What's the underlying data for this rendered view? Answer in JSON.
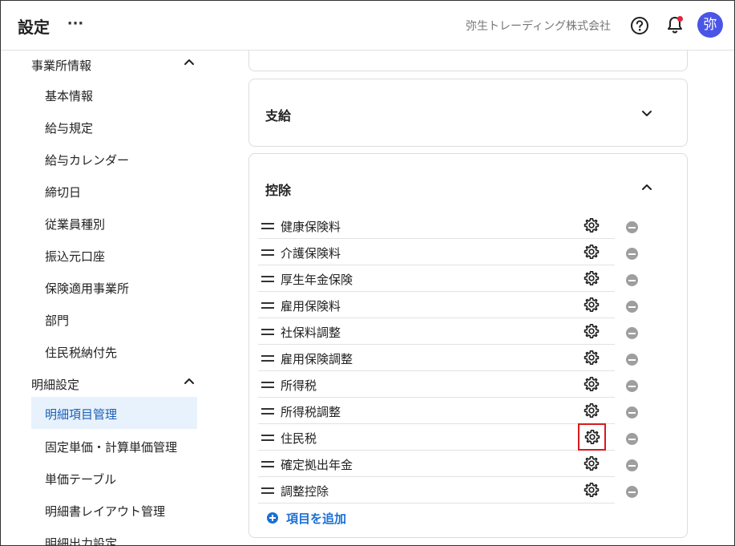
{
  "header": {
    "title": "設定",
    "more_label": "···",
    "company": "弥生トレーディング株式会社",
    "help_icon": "question-circle-icon",
    "bell_icon": "bell-icon",
    "avatar_text": "弥"
  },
  "sidebar": {
    "groups": [
      {
        "label": "事業所情報",
        "expanded": true,
        "items": [
          {
            "label": "基本情報"
          },
          {
            "label": "給与規定"
          },
          {
            "label": "給与カレンダー"
          },
          {
            "label": "締切日"
          },
          {
            "label": "従業員種別"
          },
          {
            "label": "振込元口座"
          },
          {
            "label": "保険適用事業所"
          },
          {
            "label": "部門"
          },
          {
            "label": "住民税納付先"
          }
        ]
      },
      {
        "label": "明細設定",
        "expanded": true,
        "items": [
          {
            "label": "明細項目管理",
            "active": true
          },
          {
            "label": "固定単価・計算単価管理"
          },
          {
            "label": "単価テーブル"
          },
          {
            "label": "明細書レイアウト管理"
          },
          {
            "label": "明細出力設定"
          }
        ]
      }
    ]
  },
  "main": {
    "sections": [
      {
        "title": "支給",
        "expanded": false
      },
      {
        "title": "控除",
        "expanded": true,
        "items": [
          {
            "name": "健康保険料"
          },
          {
            "name": "介護保険料"
          },
          {
            "name": "厚生年金保険"
          },
          {
            "name": "雇用保険料"
          },
          {
            "name": "社保料調整"
          },
          {
            "name": "雇用保険調整"
          },
          {
            "name": "所得税"
          },
          {
            "name": "所得税調整"
          },
          {
            "name": "住民税",
            "highlighted": true
          },
          {
            "name": "確定拠出年金"
          },
          {
            "name": "調整控除"
          }
        ],
        "add_label": "項目を追加"
      }
    ]
  },
  "colors": {
    "accent": "#1a6fd4",
    "avatar_bg": "#4a55e6",
    "notification_dot": "#e8213a",
    "highlight_border": "#d9191c",
    "active_bg": "#e8f2fd"
  }
}
